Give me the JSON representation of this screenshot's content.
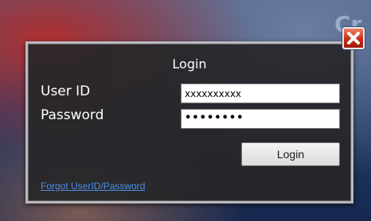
{
  "background": {
    "partial_text": "Cr"
  },
  "dialog": {
    "title": "Login",
    "user_id_label": "User ID",
    "password_label": "Password",
    "user_id_value": "xxxxxxxxxx",
    "password_masked": "••••••••",
    "login_button": "Login",
    "forgot_link": "Forgot UserID/Password",
    "close_icon": "close-icon"
  },
  "colors": {
    "dialog_bg": "#262628",
    "link": "#4d8fe8",
    "close_red": "#c62c16"
  }
}
